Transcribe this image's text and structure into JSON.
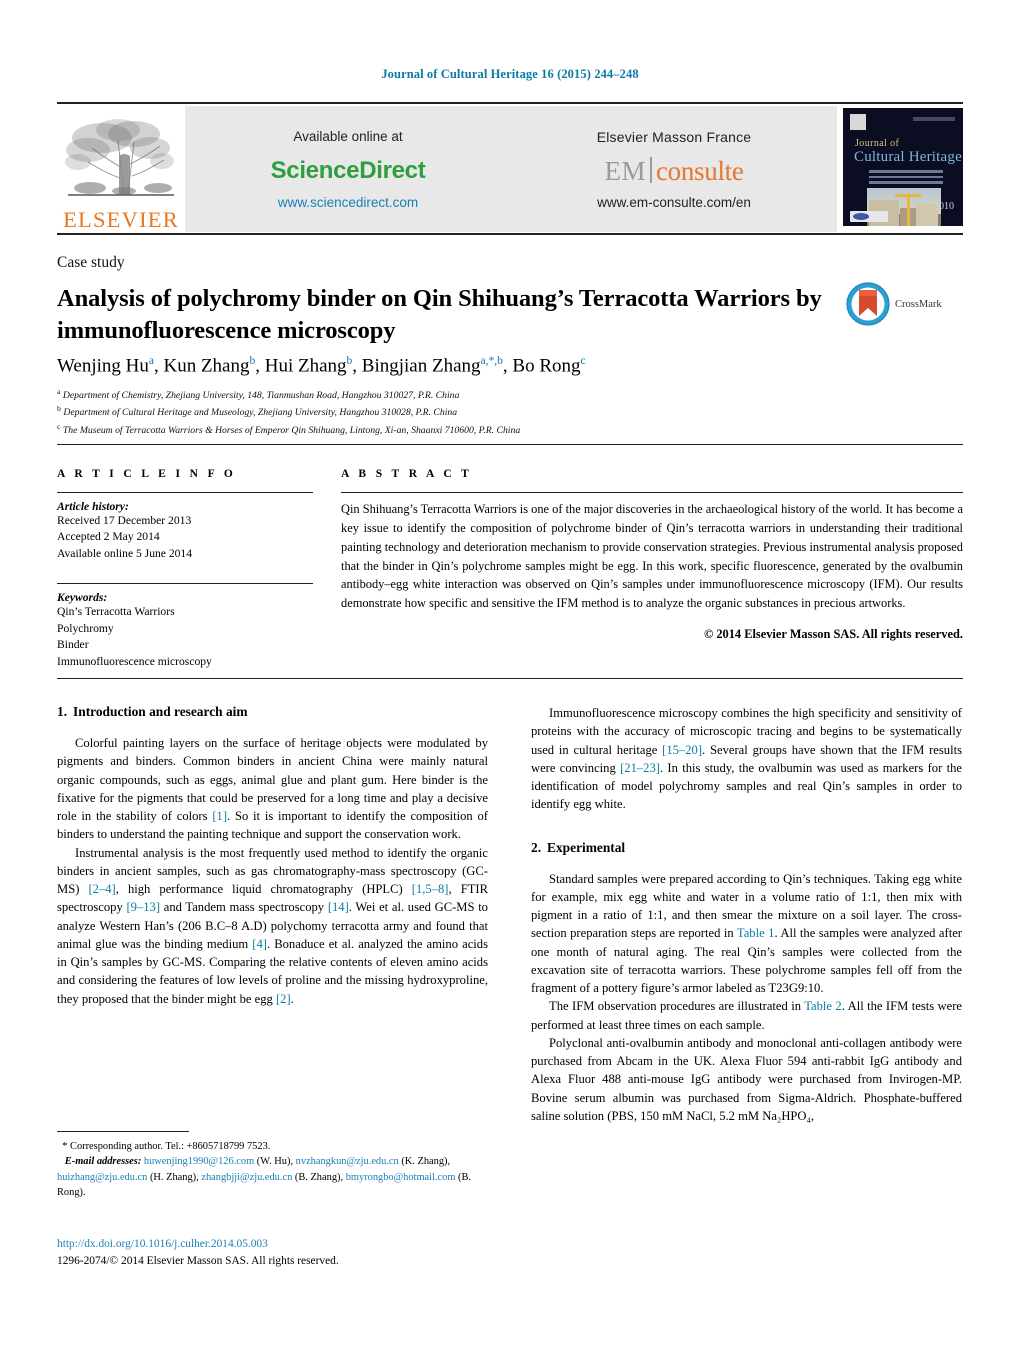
{
  "journal_head": "Journal of Cultural Heritage 16 (2015) 244–248",
  "banner": {
    "elsevier_wordmark": "ELSEVIER",
    "available_online": "Available online at",
    "sciencedirect_name": "ScienceDirect",
    "sciencedirect_url": "www.sciencedirect.com",
    "publisher": "Elsevier Masson France",
    "em_first": "EM",
    "em_second": "consulte",
    "em_url": "www.em-consulte.com/en",
    "cover": {
      "journal_word": "Journal of",
      "title_main": "Cultural Heritage",
      "year": "2010"
    },
    "colors": {
      "sciencedirect_green": "#2f9e41",
      "link_blue": "#1a7fb5",
      "elsevier_orange": "#E87722",
      "em_orange": "#E8762C",
      "panel_grey": "#e8e8e8"
    }
  },
  "article": {
    "type_label": "Case study",
    "title": "Analysis of polychromy binder on Qin Shihuang’s Terracotta Warriors by immunofluorescence microscopy",
    "crossmark_label": "CrossMark",
    "authors_html": "Wenjing Hu<sup>a</sup>, Kun Zhang<sup>b</sup>, Hui Zhang<sup>b</sup>, Bingjian Zhang<sup>a,*,b</sup>, Bo Rong<sup>c</sup>",
    "affiliations": [
      "Department of Chemistry, Zhejiang University, 148, Tianmushan Road, Hangzhou 310027, P.R. China",
      "Department of Cultural Heritage and Museology, Zhejiang University, Hangzhou 310028, P.R. China",
      "The Museum of Terracotta Warriors & Horses of Emperor Qin Shihuang, Lintong, Xi-an, Shaanxi 710600, P.R. China"
    ],
    "affiliation_marks": [
      "a",
      "b",
      "c"
    ]
  },
  "article_info": {
    "section_label": "A R T I C L E   I N F O",
    "history_label": "Article history:",
    "history": [
      "Received 17 December 2013",
      "Accepted 2 May 2014",
      "Available online 5 June 2014"
    ],
    "keywords_label": "Keywords:",
    "keywords": [
      "Qin’s Terracotta Warriors",
      "Polychromy",
      "Binder",
      "Immunofluorescence microscopy"
    ]
  },
  "abstract": {
    "section_label": "A B S T R A C T",
    "text": "Qin Shihuang’s Terracotta Warriors is one of the major discoveries in the archaeological history of the world. It has become a key issue to identify the composition of polychrome binder of Qin’s terracotta warriors in understanding their traditional painting technology and deterioration mechanism to provide conservation strategies. Previous instrumental analysis proposed that the binder in Qin’s polychrome samples might be egg. In this work, specific fluorescence, generated by the ovalbumin antibody–egg white interaction was observed on Qin’s samples under immunofluorescence microscopy (IFM). Our results demonstrate how specific and sensitive the IFM method is to analyze the organic substances in precious artworks.",
    "copyright": "© 2014 Elsevier Masson SAS. All rights reserved."
  },
  "body": {
    "section1": {
      "number": "1.",
      "heading": "Introduction and research aim",
      "paragraph1_a": "Colorful painting layers on the surface of heritage objects were modulated by pigments and binders. Common binders in ancient China were mainly natural organic compounds, such as eggs, animal glue and plant gum. Here binder is the fixative for the pigments that could be preserved for a long time and play a decisive role in the stability of colors ",
      "paragraph1_ref": "[1]",
      "paragraph1_b": ". So it is important to identify the composition of binders to understand the painting technique and support the conservation work.",
      "paragraph2_parts": [
        {
          "t": "Instrumental analysis is the most frequently used method to identify the organic binders in ancient samples, such as gas chromatography-mass spectroscopy (GC-MS) ",
          "r": false
        },
        {
          "t": "[2–4]",
          "r": true
        },
        {
          "t": ", high performance liquid chromatography (HPLC) ",
          "r": false
        },
        {
          "t": "[1,5–8]",
          "r": true
        },
        {
          "t": ", FTIR spectroscopy ",
          "r": false
        },
        {
          "t": "[9–13]",
          "r": true
        },
        {
          "t": " and Tandem mass spectroscopy ",
          "r": false
        },
        {
          "t": "[14]",
          "r": true
        },
        {
          "t": ". Wei et al. used GC-MS to analyze Western Han’s (206 B.C–8 A.D) polychomy terracotta army and found that animal glue was the binding medium ",
          "r": false
        },
        {
          "t": "[4]",
          "r": true
        },
        {
          "t": ". Bonaduce et al. analyzed the amino acids in Qin’s samples by GC-MS. Comparing the relative contents of eleven amino acids and considering the features of low levels of proline and the missing hydroxyproline, they proposed that the binder might be egg ",
          "r": false
        },
        {
          "t": "[2]",
          "r": true
        },
        {
          "t": ".",
          "r": false
        }
      ]
    },
    "right_intro_parts": [
      {
        "t": "Immunofluorescence microscopy combines the high specificity and sensitivity of proteins with the accuracy of microscopic tracing and begins to be systematically used in cultural heritage ",
        "r": false
      },
      {
        "t": "[15–20]",
        "r": true
      },
      {
        "t": ". Several groups have shown that the IFM results were convincing ",
        "r": false
      },
      {
        "t": "[21–23]",
        "r": true
      },
      {
        "t": ". In this study, the ovalbumin was used as markers for the identification of model polychromy samples and real Qin’s samples in order to identify egg white.",
        "r": false
      }
    ],
    "section2": {
      "number": "2.",
      "heading": "Experimental",
      "paragraph1_parts": [
        {
          "t": "Standard samples were prepared according to Qin’s techniques. Taking egg white for example, mix egg white and water in a volume ratio of 1:1, then mix with pigment in a ratio of 1:1, and then smear the mixture on a soil layer. The cross-section preparation steps are reported in ",
          "r": false
        },
        {
          "t": "Table 1",
          "r": true
        },
        {
          "t": ". All the samples were analyzed after one month of natural aging. The real Qin’s samples were collected from the excavation site of terracotta warriors. These polychrome samples fell off from the fragment of a pottery figure’s armor labeled as T23G9:10.",
          "r": false
        }
      ],
      "paragraph2_parts": [
        {
          "t": "The IFM observation procedures are illustrated in ",
          "r": false
        },
        {
          "t": "Table 2",
          "r": true
        },
        {
          "t": ". All the IFM tests were performed at least three times on each sample.",
          "r": false
        }
      ],
      "paragraph3": "Polyclonal anti-ovalbumin antibody and monoclonal anti-collagen antibody were purchased from Abcam in the UK. Alexa Fluor 594 anti-rabbit IgG antibody and Alexa Fluor 488 anti-mouse IgG antibody were purchased from Invirogen-MP. Bovine serum albumin was purchased from Sigma-Aldrich. Phosphate-buffered saline solution (PBS, 150 mM NaCl, 5.2 mM Na₂HPO₄,"
    }
  },
  "footnote": {
    "corresponding_marker": "*",
    "corresponding_text": "Corresponding author. Tel.: +8605718799 7523.",
    "email_label": "E-mail addresses:",
    "emails": [
      {
        "address": "huwenjing1990@126.com",
        "who": "(W. Hu)"
      },
      {
        "address": "nvzhangkun@zju.edu.cn",
        "who": "(K. Zhang)"
      },
      {
        "address": "huizhang@zju.edu.cn",
        "who": "(H. Zhang)"
      },
      {
        "address": "zhangbjji@zju.edu.cn",
        "who": "(B. Zhang)"
      },
      {
        "address": "bmyrongbo@hotmail.com",
        "who": "(B. Rong)"
      }
    ],
    "doi": "http://dx.doi.org/10.1016/j.culher.2014.05.003",
    "issn_line": "1296-2074/© 2014 Elsevier Masson SAS. All rights reserved."
  }
}
